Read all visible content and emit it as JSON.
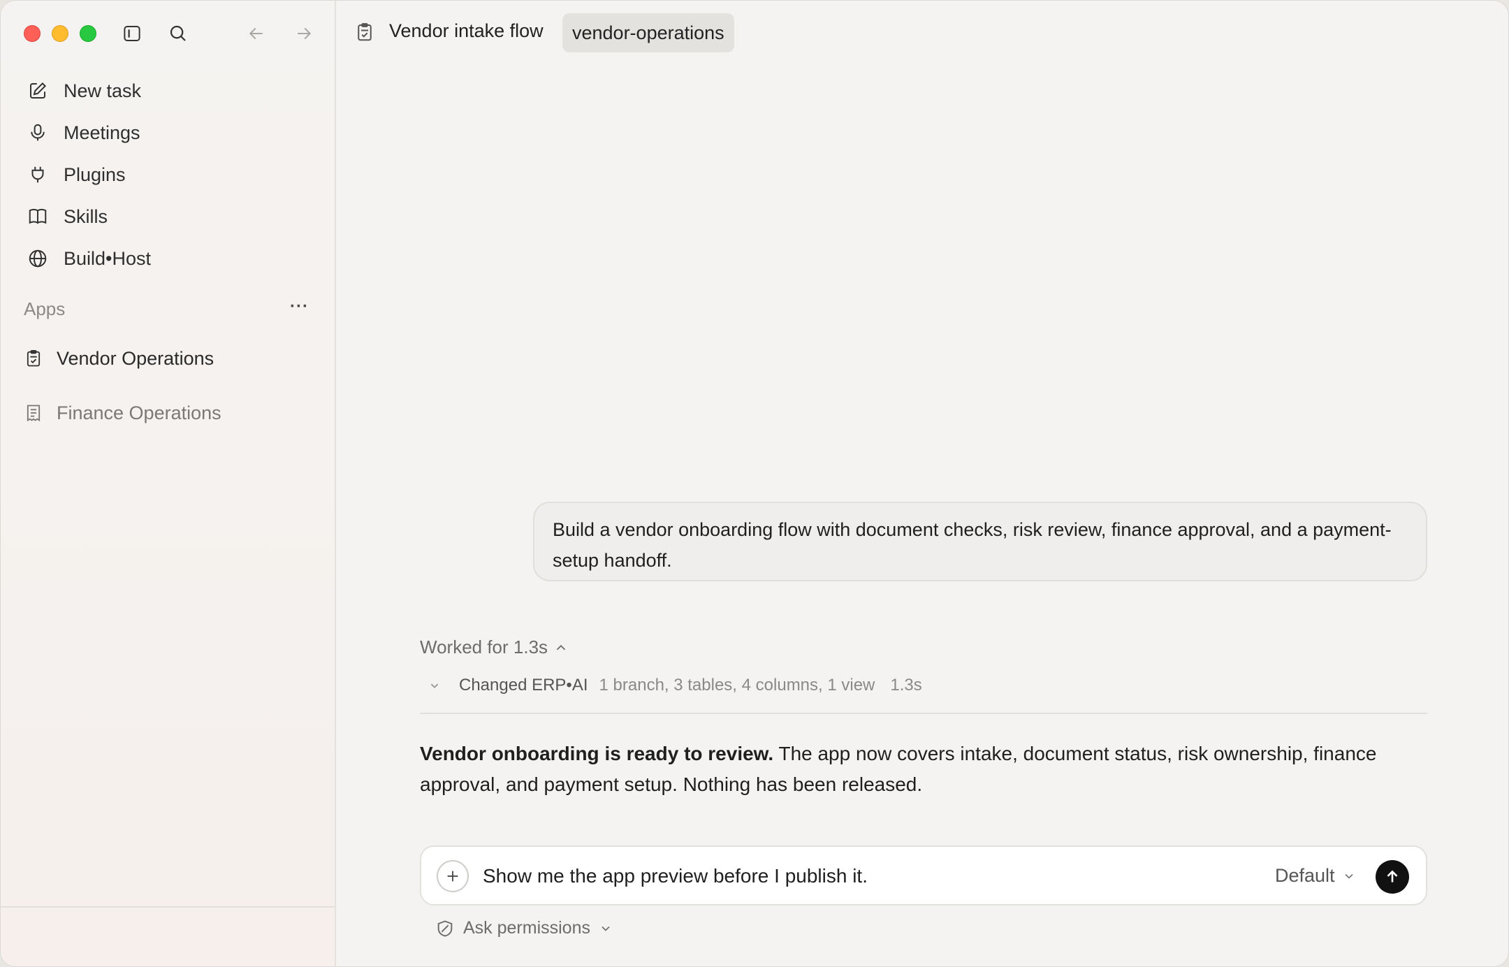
{
  "sidebar": {
    "nav": [
      {
        "label": "New task",
        "icon": "edit-icon"
      },
      {
        "label": "Meetings",
        "icon": "microphone-icon"
      },
      {
        "label": "Plugins",
        "icon": "plug-icon"
      },
      {
        "label": "Skills",
        "icon": "book-icon"
      },
      {
        "label": "Build•Host",
        "icon": "globe-icon"
      }
    ],
    "apps_header": "Apps",
    "apps_more": "···",
    "apps": [
      {
        "label": "Vendor Operations",
        "icon": "clipboard-check-icon",
        "active": true
      },
      {
        "label": "Finance Operations",
        "icon": "receipt-icon",
        "active": false
      }
    ]
  },
  "header": {
    "title": "Vendor intake flow",
    "pill": "vendor-operations"
  },
  "conversation": {
    "user_message": "Build a vendor onboarding flow with document checks, risk review, finance approval, and a payment-setup handoff.",
    "worked_label": "Worked for 1.3s",
    "changed": {
      "label": "Changed ERP•AI",
      "detail": "1 branch, 3 tables, 4 columns, 1 view",
      "time": "1.3s"
    },
    "summary_bold": "Vendor onboarding is ready to review.",
    "summary_rest": " The app now covers intake, document status, risk ownership, finance approval, and payment setup. Nothing has been released."
  },
  "composer": {
    "value": "Show me the app preview before I publish it.",
    "model": "Default",
    "permissions": "Ask permissions"
  },
  "colors": {
    "accent_send": "#111111",
    "traffic_red": "#fe5f57",
    "traffic_yellow": "#febc2e",
    "traffic_green": "#28c840"
  }
}
